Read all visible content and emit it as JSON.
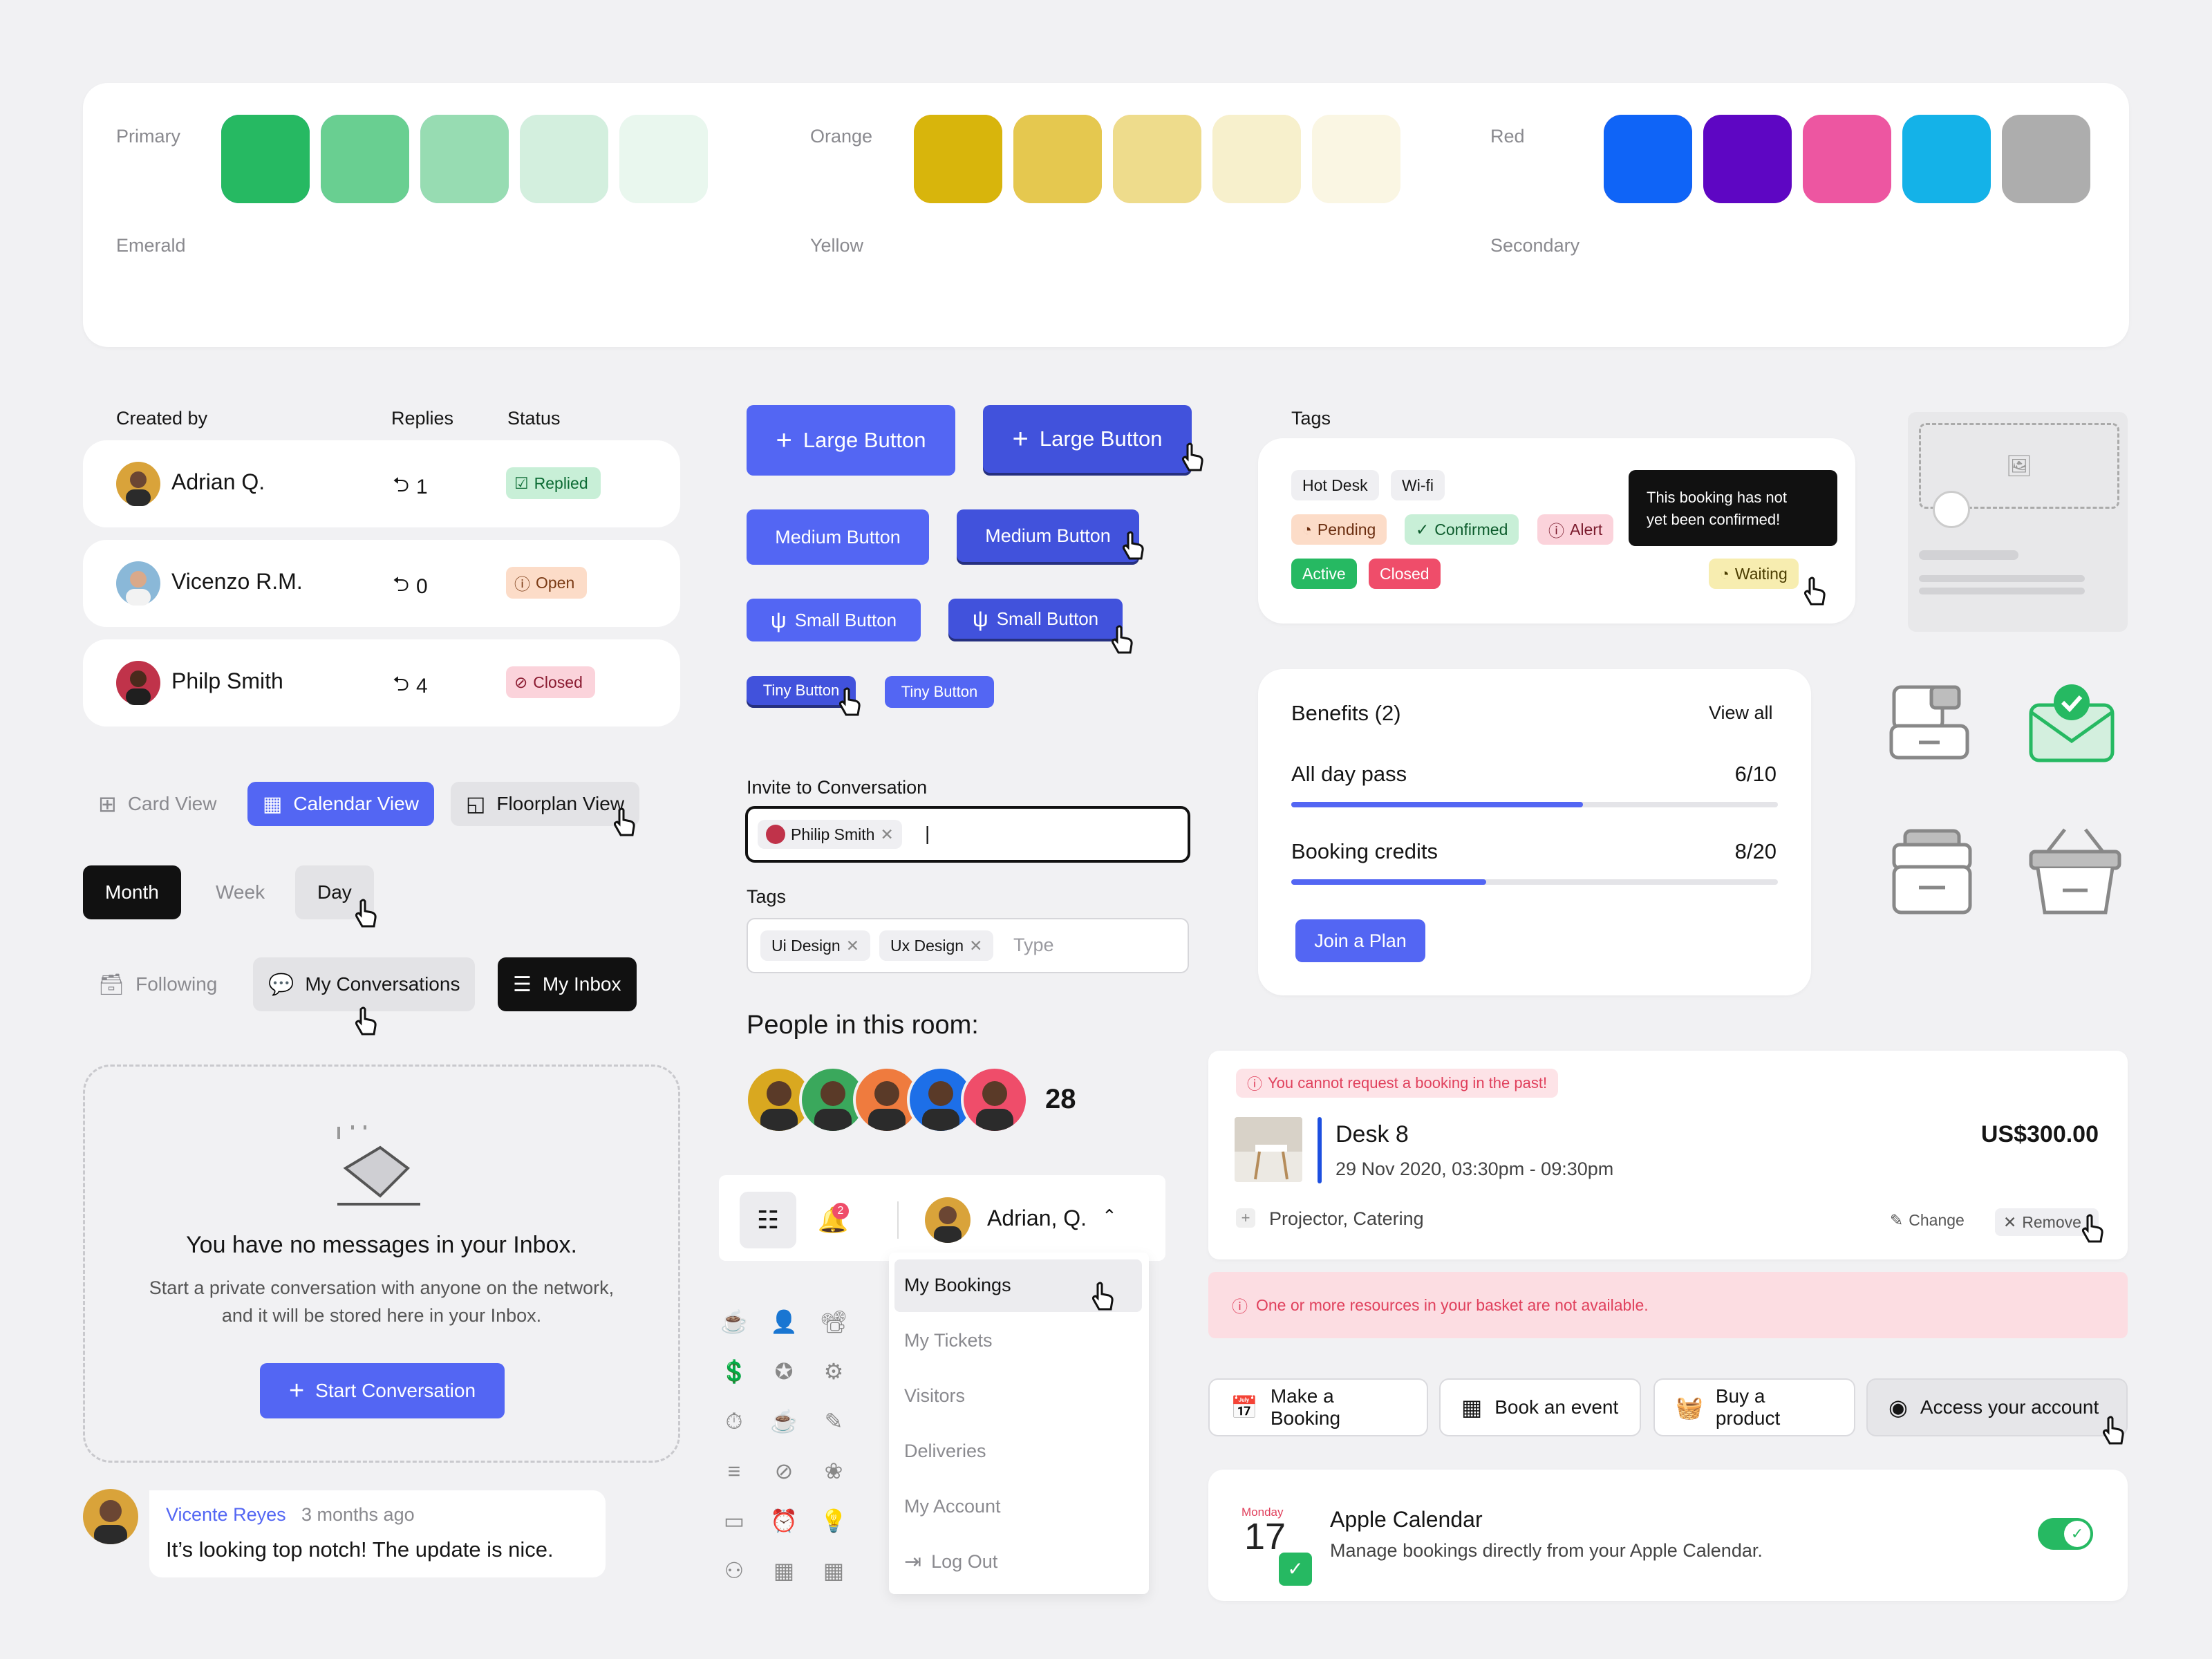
{
  "palette": {
    "groups": [
      {
        "label": "Primary",
        "colors": [
          "#5566f7",
          "#8592f7",
          "#aab3f9",
          "#dcdffb",
          "#eceefb"
        ]
      },
      {
        "label": "Emerald",
        "colors": [
          "#26b962",
          "#69cf91",
          "#97dcb2",
          "#d3efde",
          "#e9f7ee"
        ]
      },
      {
        "label": "Orange",
        "colors": [
          "#ef7b3e",
          "#f4a478",
          "#f7bf9f",
          "#fbe2d6",
          "#fbf0ea"
        ]
      },
      {
        "label": "Yellow",
        "colors": [
          "#d8b50c",
          "#e5c84f",
          "#eedc8c",
          "#f7f0cc",
          "#faf6e3"
        ]
      },
      {
        "label": "Red",
        "colors": [
          "#ef4d6a",
          "#f48497",
          "#f6b4c1",
          "#fbdbe1",
          "#fcebee"
        ]
      },
      {
        "label": "Secondary",
        "colors": [
          "#0f64f7",
          "#5e06c3",
          "#ed56a1",
          "#14b2e8",
          "#adadad"
        ]
      }
    ]
  },
  "table": {
    "headers": {
      "created_by": "Created by",
      "replies": "Replies",
      "status": "Status"
    },
    "rows": [
      {
        "name": "Adrian Q.",
        "replies": "1",
        "status": "Replied",
        "avatar_color": "#d9a33a"
      },
      {
        "name": "Vicenzo R.M.",
        "replies": "0",
        "status": "Open",
        "avatar_color": "#8ab8d8"
      },
      {
        "name": "Philp Smith",
        "replies": "4",
        "status": "Closed",
        "avatar_color": "#c0334a"
      }
    ]
  },
  "views": {
    "card": "Card View",
    "calendar": "Calendar View",
    "floorplan": "Floorplan View"
  },
  "periods": {
    "month": "Month",
    "week": "Week",
    "day": "Day"
  },
  "filters": {
    "following": "Following",
    "my_conversations": "My Conversations",
    "my_inbox": "My Inbox"
  },
  "empty_inbox": {
    "title": "You have no messages in your Inbox.",
    "line1": "Start a private conversation with anyone on the network,",
    "line2": "and it will be stored here in your Inbox.",
    "button": "Start Conversation"
  },
  "comment": {
    "author": "Vicente Reyes",
    "time": "3 months ago",
    "text": "It’s looking top notch! The update is nice."
  },
  "buttons": {
    "large": "Large Button",
    "medium": "Medium Button",
    "small": "Small Button",
    "tiny": "Tiny Button"
  },
  "invite": {
    "label": "Invite to Conversation",
    "chip": "Philip Smith",
    "caret": "|"
  },
  "tags_input": {
    "label": "Tags",
    "chips": [
      "Ui Design",
      "Ux Design"
    ],
    "placeholder": "Type"
  },
  "people": {
    "title": "People in this room:",
    "count": "28",
    "avatar_colors": [
      "#d9a820",
      "#3aa85c",
      "#ef7b3e",
      "#1d6fe8",
      "#ef4d6a"
    ]
  },
  "header_bar": {
    "user": "Adrian, Q.",
    "badge": "2"
  },
  "dropdown": {
    "items": [
      "My Bookings",
      "My Tickets",
      "Visitors",
      "Deliveries",
      "My Account",
      "Log Out"
    ]
  },
  "tags_card": {
    "title": "Tags",
    "tags": [
      "Hot Desk",
      "Wi-fi",
      "Pending",
      "Confirmed",
      "Alert",
      "Active",
      "Closed",
      "Waiting"
    ],
    "tooltip_line1": "This booking has not",
    "tooltip_line2": "yet been confirmed!"
  },
  "benefits": {
    "title": "Benefits (2)",
    "view_all": "View all",
    "items": [
      {
        "label": "All day pass",
        "value": "6/10",
        "progress": 0.6
      },
      {
        "label": "Booking credits",
        "value": "8/20",
        "progress": 0.4
      }
    ],
    "button": "Join a Plan"
  },
  "booking": {
    "error": "You cannot request a booking in the past!",
    "title": "Desk 8",
    "date": "29 Nov 2020, 03:30pm - 09:30pm",
    "price": "US$300.00",
    "extras": "Projector, Catering",
    "change": "Change",
    "remove": "Remove",
    "alert": "One or more resources in your basket are not available."
  },
  "actions": {
    "booking": "Make a Booking",
    "event": "Book an event",
    "product": "Buy a product",
    "account": "Access your account"
  },
  "calendar": {
    "day_name": "Monday",
    "day": "17",
    "title": "Apple Calendar",
    "desc": "Manage bookings directly from your Apple Calendar.",
    "enabled": true
  },
  "icons": [
    "coffee-icon",
    "add-user-icon",
    "projector-icon",
    "money-icon",
    "badge-icon",
    "plan-icon",
    "timer-icon",
    "cup-icon",
    "pencil-icon",
    "sliders-icon",
    "no-photo-icon",
    "delivery-icon",
    "screen-icon",
    "alarm-icon",
    "lightbulb-icon",
    "robot-icon",
    "calendar-icon",
    "calendar-grid-icon"
  ]
}
